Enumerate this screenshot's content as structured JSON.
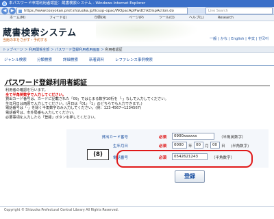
{
  "window": {
    "title": "本パスワード申請利用者認証：蔵書検索システム - Windows Internet Explorer"
  },
  "address_bar": {
    "url": "https://www.tosyokan.pref.shizuoka.jp/licsxp-opac/WOpacAplPwdChkDispAction.do",
    "search_placeholder": "Live Search"
  },
  "command_bar": {
    "home": "ホーム(M)",
    "feeds": "フィード(J)",
    "print": "印刷(R)",
    "page": "ページ(P)",
    "tools": "ツール(O)",
    "help": "ヘルプ(L)",
    "research": "Research"
  },
  "header": {
    "title": "蔵書検索システム",
    "subtitle": "当館の本をさがす・予約する",
    "lang_links": "一般 | かな | English | 中文 | 한국어"
  },
  "breadcrumb": {
    "items": [
      "トップページ",
      "利用関係全部",
      "パスワード登録利用者用画面"
    ],
    "current": "利用者認証"
  },
  "top_menu": [
    "ジャンル検索",
    "分類検索",
    "詳細検索",
    "新着資料",
    "レファレンス事例検索"
  ],
  "main": {
    "page_title": "パスワード登録利用者認証",
    "intro_lines": [
      "利用者の確認を行います。",
      "全て半角英数字で入力してください。",
      "貸出カード番号は、カードに記載された「09」ではじまる数字10桁を「-」なしで入力してください。",
      "生年月日は西暦で入力してください。(月日は「01」「1」のどちらでも入力できます。)",
      "電話番号は「-」を除く半角数字のみ入力してください。(例：123-4567→1234567)",
      "電話番号は、市外局番も入力してください。",
      "必要事項を入力したら「登録」ボタンを押してください。"
    ]
  },
  "form": {
    "card_label": "貸出カード番号",
    "card_value": "0900xxxxxx",
    "card_hint": "（半角英数字）",
    "birth_label": "生年月日",
    "birth_year": "0000",
    "birth_year_unit": "年",
    "birth_month": "00",
    "birth_month_unit": "月",
    "birth_day": "00",
    "birth_day_unit": "日",
    "birth_hint": "(半角数字)",
    "phone_label": "電話番号",
    "phone_value": "0542621243",
    "phone_hint": "（半角数字）",
    "required": "必須",
    "submit_label": "登録",
    "annotation": "(8)"
  },
  "footer": {
    "text": "Copyright © Shizuoka Prefectural Central Library All Rights Reserved."
  },
  "colors": {
    "accent": "#1a4fa0",
    "required": "#dd0000",
    "highlight": "#e01818"
  }
}
